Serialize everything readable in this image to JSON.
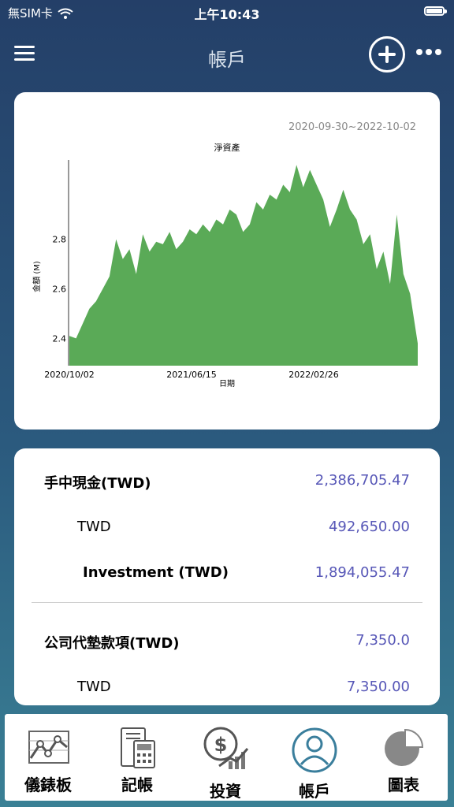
{
  "status": {
    "carrier": "無SIM卡",
    "time": "上午10:43"
  },
  "nav": {
    "title": "帳戶"
  },
  "chart_data": {
    "type": "area",
    "date_range": "2020-09-30~2022-10-02",
    "title": "淨資產",
    "xlabel": "日期",
    "ylabel": "金額 (M)",
    "x_ticks": [
      "2020/10/02",
      "2021/06/15",
      "2022/02/26"
    ],
    "y_ticks": [
      "2.4",
      "2.6",
      "2.8"
    ],
    "ylim": [
      2.29,
      3.12
    ],
    "color": "#5aaa57",
    "x": [
      "2020-10-02",
      "2020-10-16",
      "2020-10-30",
      "2020-11-13",
      "2020-11-27",
      "2020-12-11",
      "2020-12-25",
      "2021-01-08",
      "2021-01-22",
      "2021-02-05",
      "2021-02-19",
      "2021-03-05",
      "2021-03-19",
      "2021-04-02",
      "2021-04-16",
      "2021-04-30",
      "2021-05-14",
      "2021-05-28",
      "2021-06-11",
      "2021-06-25",
      "2021-07-09",
      "2021-07-23",
      "2021-08-06",
      "2021-08-20",
      "2021-09-03",
      "2021-09-17",
      "2021-10-01",
      "2021-10-15",
      "2021-10-29",
      "2021-11-12",
      "2021-11-26",
      "2021-12-10",
      "2021-12-24",
      "2022-01-07",
      "2022-01-21",
      "2022-02-04",
      "2022-02-18",
      "2022-03-04",
      "2022-03-18",
      "2022-04-01",
      "2022-04-15",
      "2022-04-29",
      "2022-05-13",
      "2022-05-27",
      "2022-06-10",
      "2022-06-24",
      "2022-07-08",
      "2022-07-22",
      "2022-08-05",
      "2022-08-19",
      "2022-09-02",
      "2022-09-16",
      "2022-10-02"
    ],
    "values": [
      2.41,
      2.4,
      2.46,
      2.52,
      2.55,
      2.6,
      2.65,
      2.8,
      2.72,
      2.76,
      2.66,
      2.82,
      2.75,
      2.79,
      2.78,
      2.83,
      2.76,
      2.79,
      2.84,
      2.82,
      2.86,
      2.83,
      2.88,
      2.86,
      2.92,
      2.9,
      2.83,
      2.86,
      2.95,
      2.92,
      2.98,
      2.96,
      3.02,
      2.99,
      3.1,
      3.01,
      3.08,
      3.02,
      2.96,
      2.85,
      2.92,
      3.0,
      2.92,
      2.88,
      2.78,
      2.82,
      2.68,
      2.75,
      2.62,
      2.9,
      2.66,
      2.58,
      2.38
    ]
  },
  "accounts": {
    "cash_label": "手中現金(TWD)",
    "cash_value": "2,386,705.47",
    "cash_twd_label": "TWD",
    "cash_twd_value": "492,650.00",
    "investment_label": "Investment (TWD)",
    "investment_value": "1,894,055.47",
    "advance_label": "公司代墊款項(TWD)",
    "advance_value": "7,350.0",
    "advance_twd_label": "TWD",
    "advance_twd_value": "7,350.00"
  },
  "tabs": [
    {
      "label": "儀錶板",
      "icon": "dashboard-icon"
    },
    {
      "label": "記帳",
      "icon": "ledger-icon"
    },
    {
      "label": "投資",
      "icon": "investment-icon"
    },
    {
      "label": "帳戶",
      "icon": "account-icon",
      "active": true
    },
    {
      "label": "圖表",
      "icon": "pie-chart-icon"
    }
  ],
  "colors": {
    "value_text": "#5757b7",
    "active_tab": "#3a7e9c",
    "chart_fill": "#5aaa57"
  }
}
